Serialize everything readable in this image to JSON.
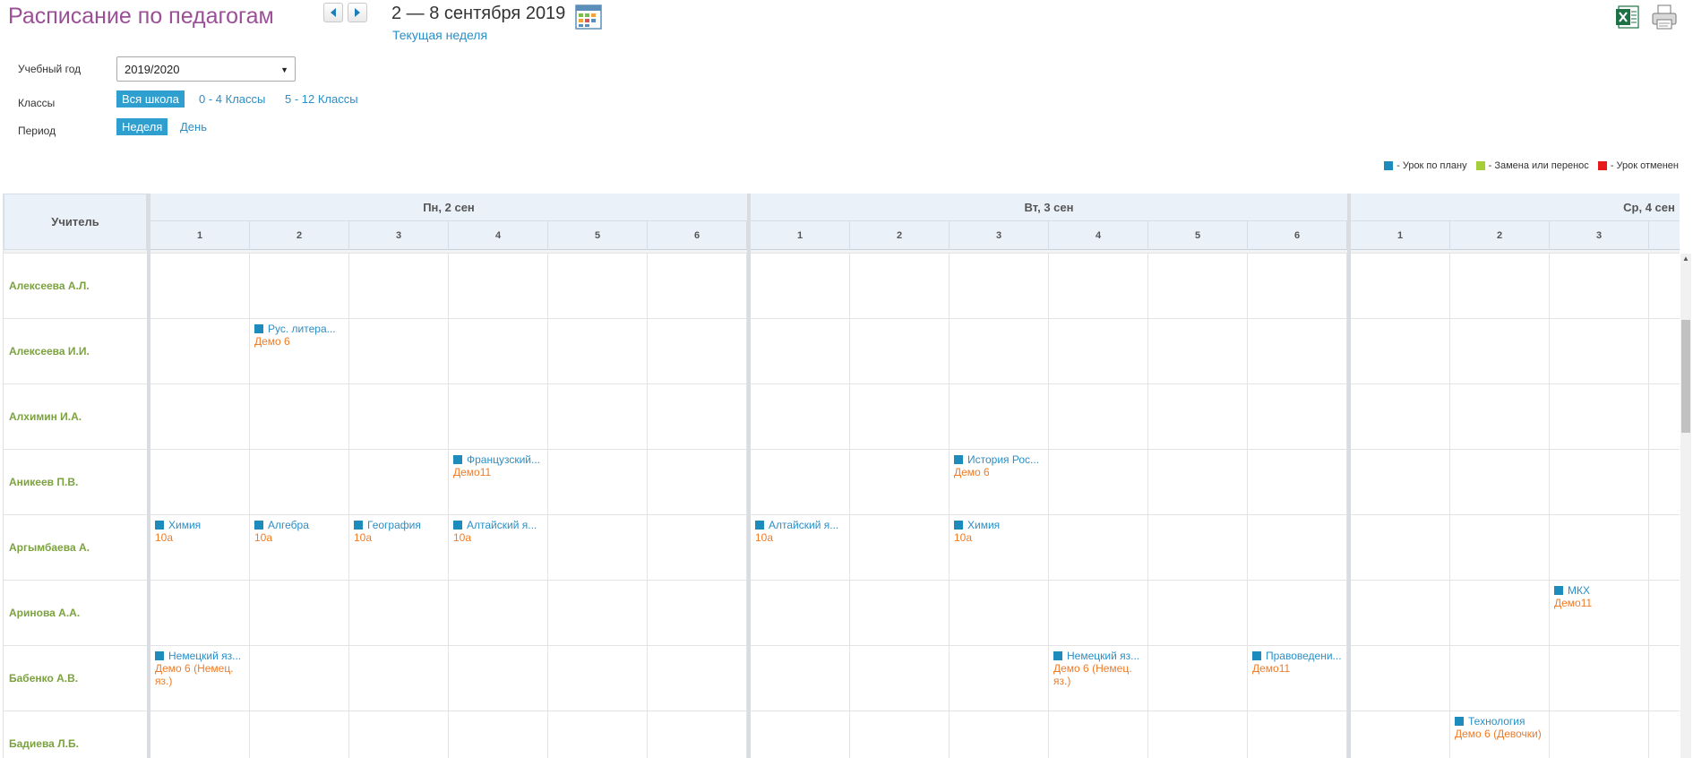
{
  "header": {
    "title": "Расписание по педагогам",
    "week_range": "2 — 8 сентября 2019",
    "current_week": "Текущая неделя"
  },
  "filters": {
    "year_label": "Учебный год",
    "year_value": "2019/2020",
    "classes_label": "Классы",
    "classes_options": [
      "Вся школа",
      "0 - 4 Классы",
      "5 - 12 Классы"
    ],
    "period_label": "Период",
    "period_options": [
      "Неделя",
      "День"
    ]
  },
  "legend": [
    {
      "label": "- Урок по плану",
      "color": "#1e8bbd"
    },
    {
      "label": "- Замена или перенос",
      "color": "#a6ce39"
    },
    {
      "label": "- Урок отменен",
      "color": "#e8191a"
    }
  ],
  "grid": {
    "teacher_header": "Учитель",
    "days": [
      "Пн,  2 сен",
      "Вт,  3 сен",
      "Ср,  4 сен"
    ],
    "periods": [
      "1",
      "2",
      "3",
      "4",
      "5",
      "6"
    ],
    "teachers": [
      {
        "name": "Алексеева А.Л.",
        "lessons": []
      },
      {
        "name": "Алексеева И.И.",
        "lessons": [
          {
            "day": 0,
            "period": 1,
            "subject": "Рус. литера...",
            "group": "Демо 6"
          }
        ]
      },
      {
        "name": "Алхимин И.А.",
        "lessons": []
      },
      {
        "name": "Аникеев П.В.",
        "lessons": [
          {
            "day": 0,
            "period": 3,
            "subject": "Французский...",
            "group": "Демо11"
          },
          {
            "day": 1,
            "period": 2,
            "subject": "История Рос...",
            "group": "Демо 6"
          }
        ]
      },
      {
        "name": "Аргымбаева А.",
        "lessons": [
          {
            "day": 0,
            "period": 0,
            "subject": "Химия",
            "group": "10а"
          },
          {
            "day": 0,
            "period": 1,
            "subject": "Алгебра",
            "group": "10а"
          },
          {
            "day": 0,
            "period": 2,
            "subject": "География",
            "group": "10а"
          },
          {
            "day": 0,
            "period": 3,
            "subject": "Алтайский я...",
            "group": "10а"
          },
          {
            "day": 1,
            "period": 0,
            "subject": "Алтайский я...",
            "group": "10а"
          },
          {
            "day": 1,
            "period": 2,
            "subject": "Химия",
            "group": "10а"
          }
        ]
      },
      {
        "name": "Аринова А.А.",
        "lessons": [
          {
            "day": 2,
            "period": 2,
            "subject": "МКХ",
            "group": "Демо11"
          }
        ]
      },
      {
        "name": "Бабенко А.В.",
        "lessons": [
          {
            "day": 0,
            "period": 0,
            "subject": "Немецкий яз...",
            "group": "Демо 6 (Немец. яз.)"
          },
          {
            "day": 1,
            "period": 3,
            "subject": "Немецкий яз...",
            "group": "Демо 6 (Немец. яз.)"
          },
          {
            "day": 1,
            "period": 5,
            "subject": "Правоведени...",
            "group": "Демо11"
          }
        ]
      },
      {
        "name": "Бадиева Л.Б.",
        "lessons": [
          {
            "day": 2,
            "period": 1,
            "subject": "Технология",
            "group": "Демо 6 (Девочки)"
          }
        ]
      }
    ]
  }
}
